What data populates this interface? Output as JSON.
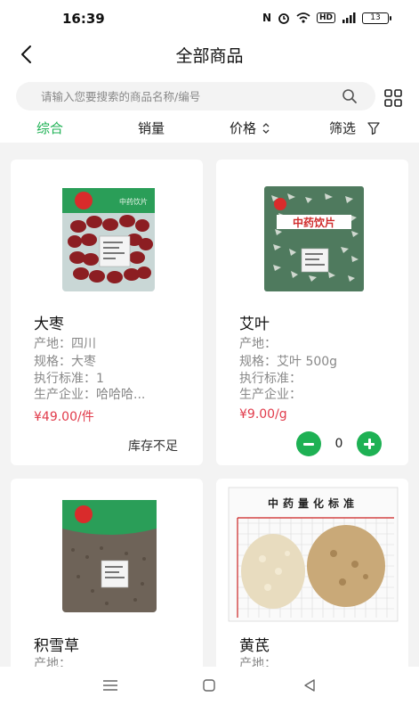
{
  "status_bar": {
    "time": "16:39",
    "battery": "13"
  },
  "header": {
    "title": "全部商品"
  },
  "search": {
    "placeholder": "请输入您要搜索的商品名称/编号"
  },
  "sort": {
    "items": [
      "综合",
      "销量",
      "价格",
      "筛选"
    ],
    "active": "综合"
  },
  "image_text": {
    "qa_chart_title": "中药量化标准",
    "pack_label_1": "中药饮片",
    "pack_label_2": "中药饮片"
  },
  "products": [
    {
      "name": "大枣",
      "origin": "产地：四川",
      "spec": "规格：大枣",
      "standard": "执行标准：1",
      "manufacturer": "生产企业：哈哈哈...",
      "price": "¥49.00/件",
      "stock_note": "库存不足"
    },
    {
      "name": "艾叶",
      "origin": "产地：",
      "spec": "规格：艾叶 500g",
      "standard": "执行标准：",
      "manufacturer": "生产企业：",
      "price": "¥9.00/g",
      "quantity": "0"
    },
    {
      "name": "积雪草",
      "origin": "产地："
    },
    {
      "name": "黄芪",
      "origin": "产地："
    }
  ],
  "colors": {
    "accent": "#1eb154",
    "price": "#e13b4b",
    "background": "#f3f3f3"
  }
}
